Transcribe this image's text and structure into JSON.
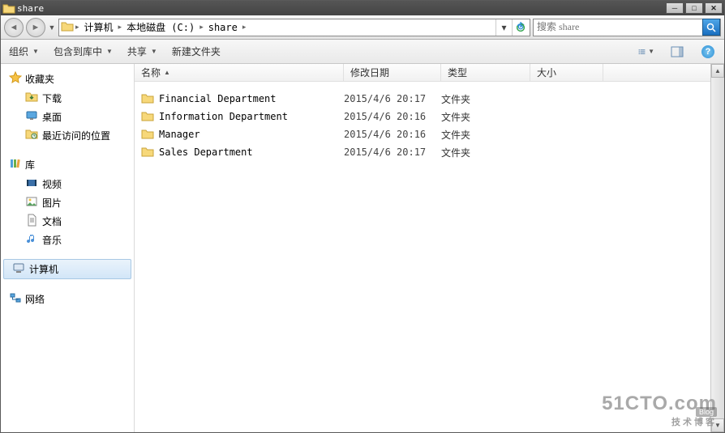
{
  "title": "share",
  "breadcrumb": {
    "computer": "计算机",
    "drive": "本地磁盘 (C:)",
    "folder": "share"
  },
  "search": {
    "placeholder": "搜索 share"
  },
  "toolbar": {
    "organize": "组织",
    "include": "包含到库中",
    "share": "共享",
    "newfolder": "新建文件夹"
  },
  "sidebar": {
    "favorites": "收藏夹",
    "downloads": "下载",
    "desktop": "桌面",
    "recent": "最近访问的位置",
    "library": "库",
    "videos": "视频",
    "pictures": "图片",
    "documents": "文档",
    "music": "音乐",
    "computer": "计算机",
    "network": "网络"
  },
  "columns": {
    "name": "名称",
    "date": "修改日期",
    "type": "类型",
    "size": "大小"
  },
  "files": [
    {
      "name": "Financial Department",
      "date": "2015/4/6 20:17",
      "type": "文件夹"
    },
    {
      "name": "Information Department",
      "date": "2015/4/6 20:16",
      "type": "文件夹"
    },
    {
      "name": "Manager",
      "date": "2015/4/6 20:16",
      "type": "文件夹"
    },
    {
      "name": "Sales Department",
      "date": "2015/4/6 20:17",
      "type": "文件夹"
    }
  ],
  "watermark": {
    "big": "51CTO.com",
    "sub": "技术博客",
    "blog": "Blog"
  }
}
